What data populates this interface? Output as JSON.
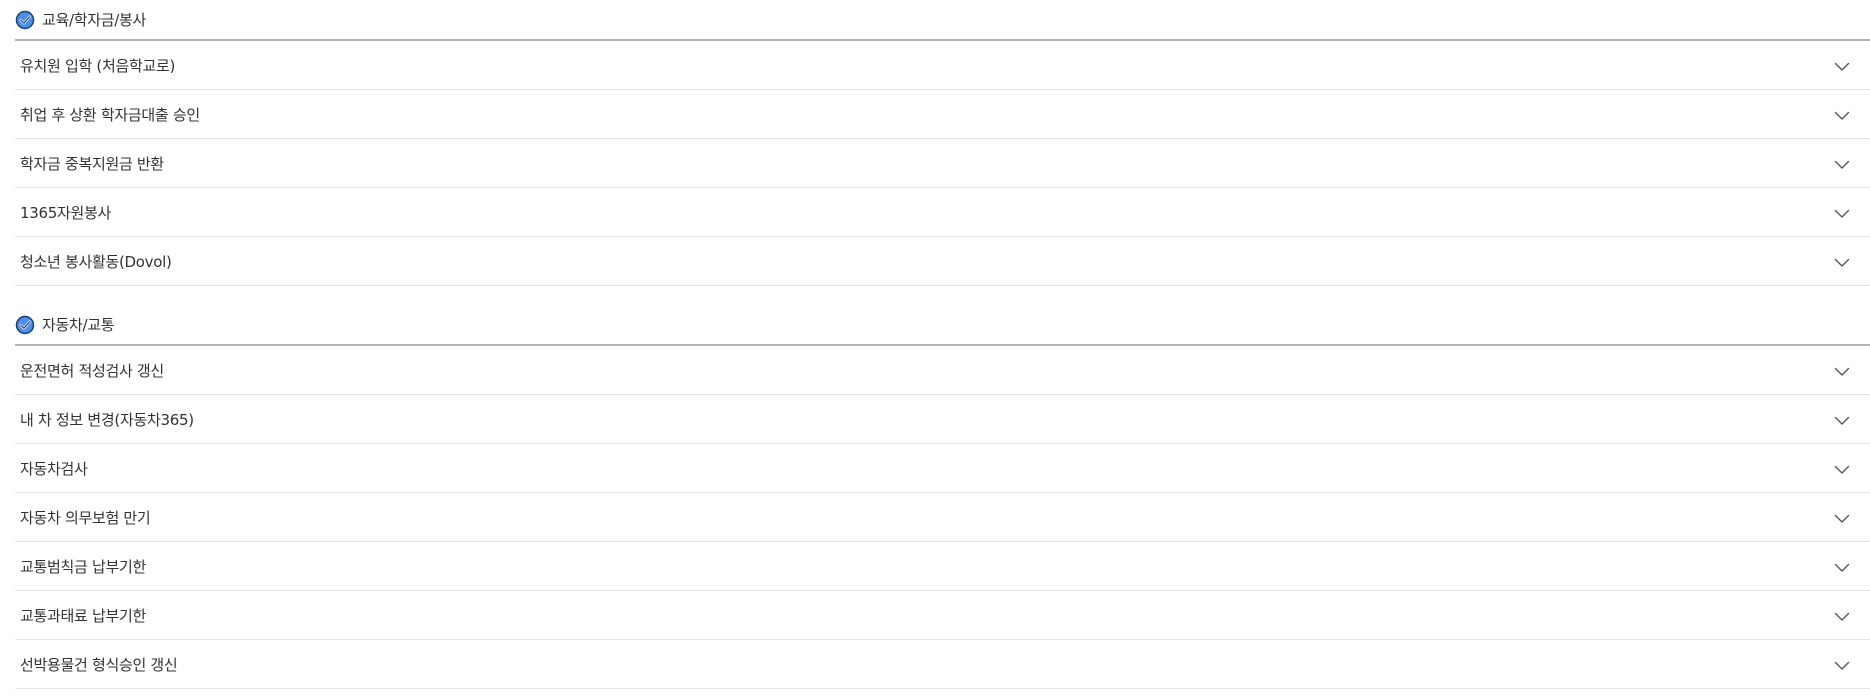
{
  "sections": [
    {
      "title": "교육/학자금/봉사",
      "items": [
        {
          "label": "유치원 입학 (처음학교로)"
        },
        {
          "label": "취업 후 상환 학자금대출 승인"
        },
        {
          "label": "학자금 중복지원금 반환"
        },
        {
          "label": "1365자원봉사"
        },
        {
          "label": "청소년 봉사활동(Dovol)"
        }
      ]
    },
    {
      "title": "자동차/교통",
      "items": [
        {
          "label": "운전면허 적성검사 갱신"
        },
        {
          "label": "내 차 정보 변경(자동차365)"
        },
        {
          "label": "자동차검사"
        },
        {
          "label": "자동차 의무보험 만기"
        },
        {
          "label": "교통범칙금 납부기한"
        },
        {
          "label": "교통과태료 납부기한"
        },
        {
          "label": "선박용물건 형식승인 갱신"
        }
      ]
    }
  ],
  "colors": {
    "accent": "#2f6fd6",
    "divider": "#b3b3b3",
    "row_border": "#e4e4e4",
    "text": "#333333"
  },
  "icons": {
    "section_marker": "check-circle-icon",
    "expand": "chevron-down-icon"
  }
}
